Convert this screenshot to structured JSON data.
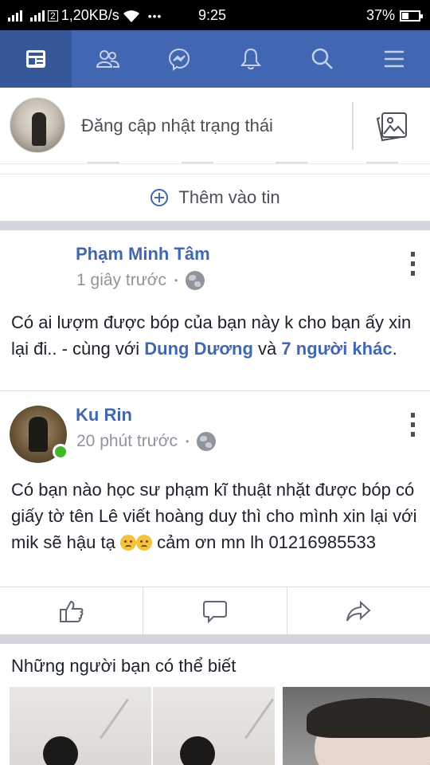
{
  "status_bar": {
    "carrier_suffix": "2",
    "speed": "1,20KB/s",
    "more": "•••",
    "time": "9:25",
    "battery": "37%",
    "battery_level": 0.37
  },
  "nav": {
    "tabs": [
      {
        "icon": "news-feed-icon",
        "active": true
      },
      {
        "icon": "friends-icon",
        "active": false
      },
      {
        "icon": "messenger-icon",
        "active": false
      },
      {
        "icon": "notifications-icon",
        "active": false
      },
      {
        "icon": "search-icon",
        "active": false
      },
      {
        "icon": "menu-icon",
        "active": false
      }
    ],
    "colors": {
      "bar": "#4267b2",
      "active": "#365899"
    }
  },
  "composer": {
    "placeholder": "Đăng cập nhật trạng thái",
    "add_story": "Thêm vào tin"
  },
  "posts": [
    {
      "author": "Phạm Minh Tâm",
      "time": "1 giây trước",
      "text_before": "Có ai lượm được bóp của bạn này k cho bạn ấy xin lại đi.. - cùng với ",
      "tag1": "Dung Dương",
      "text_mid": " và ",
      "tag2": "7 người khác",
      "text_after": "."
    },
    {
      "author": "Ku Rin",
      "time": "20 phút trước",
      "text": "Có bạn nào học sư phạm kĩ thuật nhặt được bóp có giấy tờ tên Lê viết hoàng duy thì cho mình xin lại với mik sẽ hậu tạ",
      "text_end": " cảm ơn mn lh 01216985533"
    }
  ],
  "pymk": {
    "title": "Những người bạn có thể biết"
  }
}
